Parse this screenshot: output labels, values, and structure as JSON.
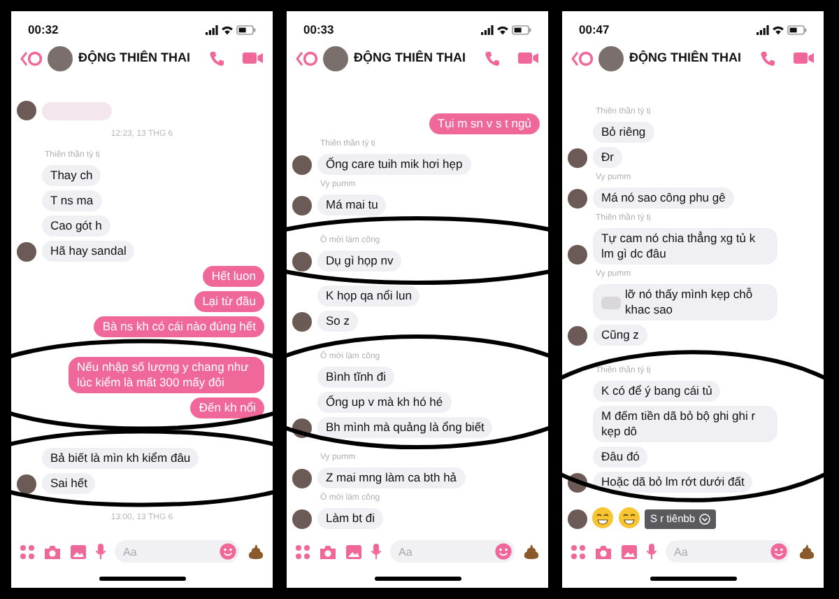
{
  "screens": [
    {
      "status_time": "00:32",
      "title": "ĐỘNG THIÊN THAI",
      "composer": {
        "placeholder": "Aa"
      },
      "messages": [
        {
          "kind": "redacted",
          "avatar": true
        },
        {
          "kind": "time",
          "text": "12:23, 13 THG 6"
        },
        {
          "kind": "label",
          "text": "Thiên thần tý tị"
        },
        {
          "kind": "incoming",
          "text": "Thay ch",
          "avatar": false
        },
        {
          "kind": "incoming",
          "text": "T ns ma",
          "avatar": false
        },
        {
          "kind": "incoming",
          "text": "Cao gót h",
          "avatar": false
        },
        {
          "kind": "incoming",
          "text": "Hã hay sandal",
          "avatar": true
        },
        {
          "kind": "outgoing",
          "text": "Hết luon"
        },
        {
          "kind": "outgoing",
          "text": "Lại từ đầu"
        },
        {
          "kind": "outgoing",
          "text": "Bà ns kh có cái nào đúng hết"
        },
        {
          "kind": "circled",
          "messages": [
            {
              "kind": "outgoing",
              "text": "Nếu nhập số lượng y chang như lúc kiểm là mất 300 mấy đôi"
            },
            {
              "kind": "outgoing",
              "text": "Đến kh nổi"
            }
          ]
        },
        {
          "kind": "circled",
          "messages": [
            {
              "kind": "incoming",
              "text": "Bả biết là mìn kh kiểm đâu",
              "avatar": false
            },
            {
              "kind": "incoming",
              "text": "Sai hết",
              "avatar": true
            }
          ]
        },
        {
          "kind": "time",
          "text": "13:00, 13 THG 6"
        }
      ]
    },
    {
      "status_time": "00:33",
      "title": "ĐỘNG THIÊN THAI",
      "composer": {
        "placeholder": "Aa"
      },
      "messages": [
        {
          "kind": "outgoing",
          "text": "Tụi m sn v s t ngủ"
        },
        {
          "kind": "label",
          "text": "Thiên thần tý tị"
        },
        {
          "kind": "incoming",
          "text": "Ống care tuih mik hơi hẹp",
          "avatar": true
        },
        {
          "kind": "label",
          "text": "Vy pumm"
        },
        {
          "kind": "incoming",
          "text": "Má mai tu",
          "avatar": true
        },
        {
          "kind": "circled",
          "messages": [
            {
              "kind": "label",
              "text": "Ô mới làm công"
            },
            {
              "kind": "incoming",
              "text": "Dụ gì họp nv",
              "avatar": true
            }
          ]
        },
        {
          "kind": "incoming",
          "text": "K họp qa nổi lun",
          "avatar": false
        },
        {
          "kind": "incoming",
          "text": "So z",
          "avatar": true
        },
        {
          "kind": "circled",
          "messages": [
            {
              "kind": "label",
              "text": "Ô mới làm công"
            },
            {
              "kind": "incoming",
              "text": "Bình tĩnh đi",
              "avatar": false
            },
            {
              "kind": "incoming",
              "text": "Ống up v mà kh hó hé",
              "avatar": false
            },
            {
              "kind": "incoming",
              "text": "Bh mình mà quảng là ổng biết",
              "avatar": true
            }
          ]
        },
        {
          "kind": "label",
          "text": "Vy pumm"
        },
        {
          "kind": "incoming",
          "text": "Z mai mng làm ca bth hả",
          "avatar": true
        },
        {
          "kind": "label",
          "text": "Ô mới làm công"
        },
        {
          "kind": "incoming",
          "text": "Làm bt đi",
          "avatar": true
        }
      ]
    },
    {
      "status_time": "00:47",
      "title": "ĐỘNG THIÊN THAI",
      "composer": {
        "placeholder": "Aa"
      },
      "messages": [
        {
          "kind": "label",
          "text": "Thiên thần tý tị"
        },
        {
          "kind": "incoming",
          "text": "Bỏ riêng",
          "avatar": false
        },
        {
          "kind": "incoming",
          "text": "Đr",
          "avatar": true
        },
        {
          "kind": "label",
          "text": "Vy pumm"
        },
        {
          "kind": "incoming",
          "text": "Má nó sao công phu gê",
          "avatar": true
        },
        {
          "kind": "label",
          "text": "Thiên thần tý tị"
        },
        {
          "kind": "incoming",
          "text": "Tự cam nó chia thẳng xg tủ k lm gì dc đâu",
          "avatar": true
        },
        {
          "kind": "label",
          "text": "Vy pumm"
        },
        {
          "kind": "incoming",
          "text": "lỡ nó thấy mình kẹp chỗ khac sao",
          "avatar": false,
          "redacted_prefix": true
        },
        {
          "kind": "incoming",
          "text": "Cũng z",
          "avatar": true
        },
        {
          "kind": "circled",
          "messages": [
            {
              "kind": "label",
              "text": "Thiên thần tý tị"
            },
            {
              "kind": "incoming",
              "text": "K có để ý bang cái tủ",
              "avatar": false
            },
            {
              "kind": "incoming",
              "text": "M đếm tiền dã bỏ bộ ghi ghi r kẹp dô",
              "avatar": false
            },
            {
              "kind": "incoming",
              "text": "Đâu đó",
              "avatar": false
            },
            {
              "kind": "incoming",
              "text": "Hoặc dã bỏ lm rớt dưới đất",
              "avatar": true
            }
          ]
        },
        {
          "kind": "stickers",
          "avatar": true,
          "reply": "S r tiênbb"
        }
      ]
    }
  ]
}
